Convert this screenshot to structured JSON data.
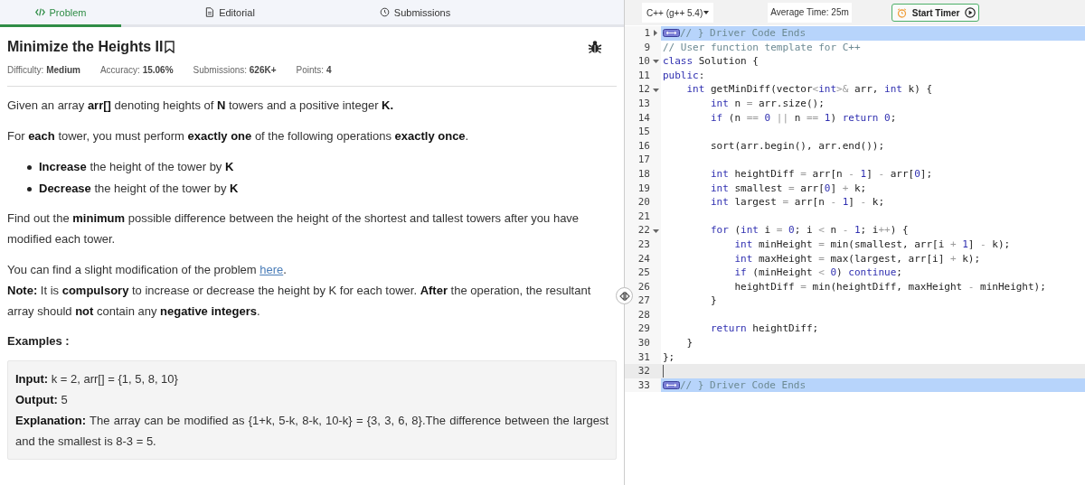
{
  "tabs": [
    {
      "label": "Problem",
      "selected": true
    },
    {
      "label": "Editorial",
      "selected": false
    },
    {
      "label": "Submissions",
      "selected": false
    }
  ],
  "problem": {
    "title": "Minimize the Heights II",
    "meta": [
      "Difficulty: **Medium**",
      "Accuracy: **15.06%**",
      "Submissions: **626K+**",
      "Points: **4**"
    ],
    "description": [
      {
        "kind": "paragraph",
        "text": "Given an array **arr[]** denoting heights of **N** towers and a positive integer **K.**"
      },
      {
        "kind": "paragraph",
        "text": "For **each** tower, you must perform **exactly one** of the following operations **exactly once**."
      },
      {
        "kind": "bullets",
        "items": [
          "**Increase** the height of the tower by **K**",
          "**Decrease** the height of the tower by **K**"
        ]
      },
      {
        "kind": "paragraph",
        "text": "Find out the **minimum** possible difference between the height of the shortest and tallest towers after you have modified each tower."
      },
      {
        "kind": "link_paragraph",
        "before": "You can find a slight modification of the problem ",
        "link": "here",
        "after": "."
      },
      {
        "kind": "paragraph",
        "text": "**Note:** It is **compulsory** to increase or decrease the height by K for each tower. **After** the operation, the resultant array should **not** contain any **negative integers**."
      },
      {
        "kind": "heading",
        "text": "Examples :"
      },
      {
        "kind": "example",
        "lines": [
          "**Input:** k = 2, arr[] = {1, 5, 8, 10}",
          "**Output:** 5",
          "**Explanation:** The array can be modified as {1+k, 5-k, 8-k, 10-k} = {3, 3, 6, 8}.The difference between the largest and the smallest is 8-3 = 5."
        ]
      }
    ]
  },
  "editor": {
    "language": "C++ (g++ 5.4)",
    "average_time": "Average Time: 25m",
    "timer_button": "Start Timer",
    "lines": [
      {
        "number": "1",
        "fold_open": false,
        "highlight": true,
        "widget": true,
        "code": [
          {
            "kind": "comment",
            "text": "// } Driver Code Ends"
          }
        ]
      },
      {
        "number": "9",
        "code": [
          {
            "kind": "comment",
            "text": "// User function template for C++"
          }
        ]
      },
      {
        "number": "10",
        "fold_open": true,
        "code": [
          {
            "kind": "keyword",
            "text": "class"
          },
          {
            "kind": "plain",
            "text": " Solution {"
          }
        ]
      },
      {
        "number": "11",
        "code": [
          {
            "kind": "keyword",
            "text": "public"
          },
          {
            "kind": "plain",
            "text": ":"
          }
        ]
      },
      {
        "number": "12",
        "fold_open": true,
        "code": [
          {
            "kind": "keyword",
            "text": "    int"
          },
          {
            "kind": "plain",
            "text": " getMinDiff(vector"
          },
          {
            "kind": "operator",
            "text": "<"
          },
          {
            "kind": "keyword",
            "text": "int"
          },
          {
            "kind": "operator",
            "text": ">&"
          },
          {
            "kind": "plain",
            "text": " arr, "
          },
          {
            "kind": "keyword",
            "text": "int"
          },
          {
            "kind": "plain",
            "text": " k) {"
          }
        ]
      },
      {
        "number": "13",
        "code": [
          {
            "kind": "keyword",
            "text": "        int"
          },
          {
            "kind": "plain",
            "text": " n "
          },
          {
            "kind": "operator",
            "text": "="
          },
          {
            "kind": "plain",
            "text": " arr.size();"
          }
        ]
      },
      {
        "number": "14",
        "code": [
          {
            "kind": "keyword",
            "text": "        if"
          },
          {
            "kind": "plain",
            "text": " (n "
          },
          {
            "kind": "operator",
            "text": "== "
          },
          {
            "kind": "number",
            "text": "0"
          },
          {
            "kind": "operator",
            "text": " || "
          },
          {
            "kind": "plain",
            "text": "n "
          },
          {
            "kind": "operator",
            "text": "== "
          },
          {
            "kind": "number",
            "text": "1"
          },
          {
            "kind": "plain",
            "text": ") "
          },
          {
            "kind": "keyword",
            "text": "return"
          },
          {
            "kind": "number",
            "text": " 0"
          },
          {
            "kind": "plain",
            "text": ";"
          }
        ]
      },
      {
        "number": "15"
      },
      {
        "number": "16",
        "code": [
          {
            "kind": "plain",
            "text": "        sort(arr.begin(), arr.end());"
          }
        ]
      },
      {
        "number": "17"
      },
      {
        "number": "18",
        "code": [
          {
            "kind": "keyword",
            "text": "        int"
          },
          {
            "kind": "plain",
            "text": " heightDiff "
          },
          {
            "kind": "operator",
            "text": "="
          },
          {
            "kind": "plain",
            "text": " arr[n "
          },
          {
            "kind": "operator",
            "text": "- "
          },
          {
            "kind": "number",
            "text": "1"
          },
          {
            "kind": "plain",
            "text": "] "
          },
          {
            "kind": "operator",
            "text": "-"
          },
          {
            "kind": "plain",
            "text": " arr["
          },
          {
            "kind": "number",
            "text": "0"
          },
          {
            "kind": "plain",
            "text": "];"
          }
        ]
      },
      {
        "number": "19",
        "code": [
          {
            "kind": "keyword",
            "text": "        int"
          },
          {
            "kind": "plain",
            "text": " smallest "
          },
          {
            "kind": "operator",
            "text": "="
          },
          {
            "kind": "plain",
            "text": " arr["
          },
          {
            "kind": "number",
            "text": "0"
          },
          {
            "kind": "plain",
            "text": "] "
          },
          {
            "kind": "operator",
            "text": "+"
          },
          {
            "kind": "plain",
            "text": " k;"
          }
        ]
      },
      {
        "number": "20",
        "code": [
          {
            "kind": "keyword",
            "text": "        int"
          },
          {
            "kind": "plain",
            "text": " largest "
          },
          {
            "kind": "operator",
            "text": "="
          },
          {
            "kind": "plain",
            "text": " arr[n "
          },
          {
            "kind": "operator",
            "text": "- "
          },
          {
            "kind": "number",
            "text": "1"
          },
          {
            "kind": "plain",
            "text": "] "
          },
          {
            "kind": "operator",
            "text": "-"
          },
          {
            "kind": "plain",
            "text": " k;"
          }
        ]
      },
      {
        "number": "21"
      },
      {
        "number": "22",
        "fold_open": true,
        "code": [
          {
            "kind": "keyword",
            "text": "        for"
          },
          {
            "kind": "plain",
            "text": " ("
          },
          {
            "kind": "keyword",
            "text": "int"
          },
          {
            "kind": "plain",
            "text": " i "
          },
          {
            "kind": "operator",
            "text": "= "
          },
          {
            "kind": "number",
            "text": "0"
          },
          {
            "kind": "plain",
            "text": "; i "
          },
          {
            "kind": "operator",
            "text": "<"
          },
          {
            "kind": "plain",
            "text": " n "
          },
          {
            "kind": "operator",
            "text": "- "
          },
          {
            "kind": "number",
            "text": "1"
          },
          {
            "kind": "plain",
            "text": "; i"
          },
          {
            "kind": "operator",
            "text": "++"
          },
          {
            "kind": "plain",
            "text": ") {"
          }
        ]
      },
      {
        "number": "23",
        "code": [
          {
            "kind": "keyword",
            "text": "            int"
          },
          {
            "kind": "plain",
            "text": " minHeight "
          },
          {
            "kind": "operator",
            "text": "="
          },
          {
            "kind": "plain",
            "text": " min(smallest, arr[i "
          },
          {
            "kind": "operator",
            "text": "+ "
          },
          {
            "kind": "number",
            "text": "1"
          },
          {
            "kind": "plain",
            "text": "] "
          },
          {
            "kind": "operator",
            "text": "-"
          },
          {
            "kind": "plain",
            "text": " k);"
          }
        ]
      },
      {
        "number": "24",
        "code": [
          {
            "kind": "keyword",
            "text": "            int"
          },
          {
            "kind": "plain",
            "text": " maxHeight "
          },
          {
            "kind": "operator",
            "text": "="
          },
          {
            "kind": "plain",
            "text": " max(largest, arr[i] "
          },
          {
            "kind": "operator",
            "text": "+"
          },
          {
            "kind": "plain",
            "text": " k);"
          }
        ]
      },
      {
        "number": "25",
        "code": [
          {
            "kind": "keyword",
            "text": "            if"
          },
          {
            "kind": "plain",
            "text": " (minHeight "
          },
          {
            "kind": "operator",
            "text": "< "
          },
          {
            "kind": "number",
            "text": "0"
          },
          {
            "kind": "plain",
            "text": ") "
          },
          {
            "kind": "keyword",
            "text": "continue"
          },
          {
            "kind": "plain",
            "text": ";"
          }
        ]
      },
      {
        "number": "26",
        "code": [
          {
            "kind": "plain",
            "text": "            heightDiff "
          },
          {
            "kind": "operator",
            "text": "="
          },
          {
            "kind": "plain",
            "text": " min(heightDiff, maxHeight "
          },
          {
            "kind": "operator",
            "text": "-"
          },
          {
            "kind": "plain",
            "text": " minHeight);"
          }
        ]
      },
      {
        "number": "27",
        "code": [
          {
            "kind": "plain",
            "text": "        }"
          }
        ]
      },
      {
        "number": "28"
      },
      {
        "number": "29",
        "code": [
          {
            "kind": "keyword",
            "text": "        return"
          },
          {
            "kind": "plain",
            "text": " heightDiff;"
          }
        ]
      },
      {
        "number": "30",
        "code": [
          {
            "kind": "plain",
            "text": "    }"
          }
        ]
      },
      {
        "number": "31",
        "code": [
          {
            "kind": "plain",
            "text": "};"
          }
        ]
      },
      {
        "number": "32",
        "current": true
      },
      {
        "number": "33",
        "highlight": true,
        "widget": true,
        "code": [
          {
            "kind": "comment",
            "text": "// } Driver Code Ends"
          }
        ]
      }
    ]
  }
}
